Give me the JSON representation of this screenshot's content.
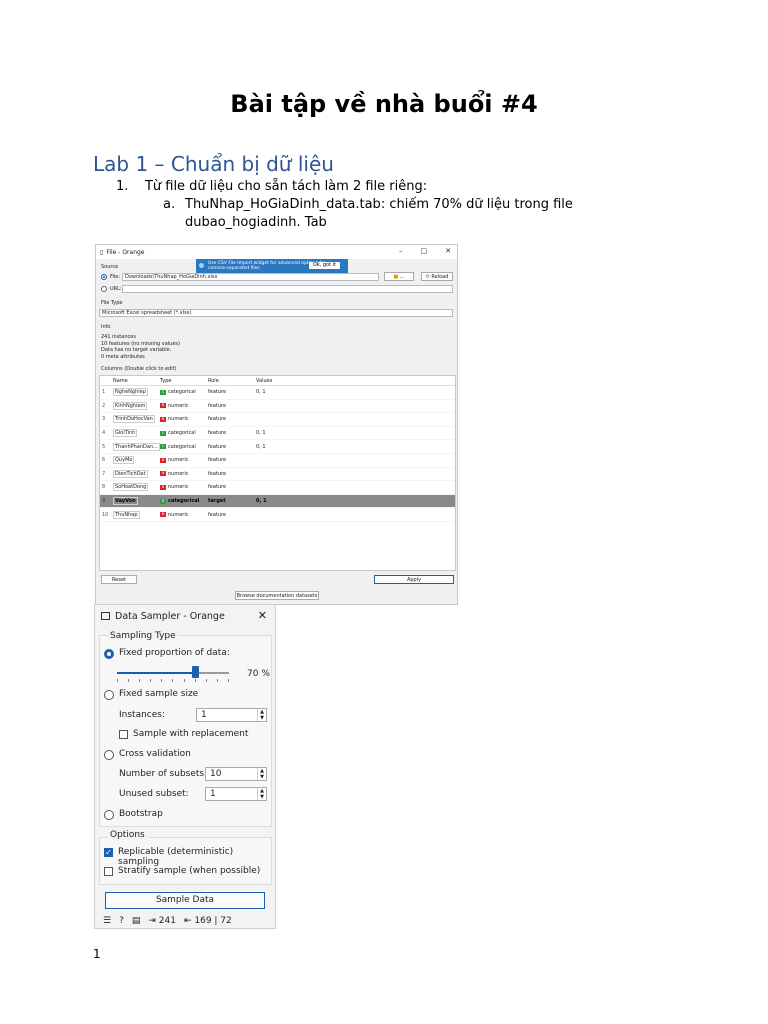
{
  "doc": {
    "title": "Bài tập về nhà buổi #4",
    "lab_heading": "Lab 1 – Chuẩn bị dữ liệu",
    "item1_marker": "1.",
    "item1_text": "Từ file dữ liệu cho sẵn tách làm 2 file riêng:",
    "itema_marker": "a.",
    "itema_text": "ThuNhap_HoGiaDinh_data.tab: chiếm 70% dữ liệu trong file dubao_hogiadinh. Tab",
    "page_number": "1"
  },
  "file_window": {
    "title": "File - Orange",
    "source_label": "Source",
    "file_label": "File:",
    "file_path": "Downloads\\ThuNhap_HoGiaDinh.xlsx",
    "url_label": "URL:",
    "browse_label": "...",
    "reload_label": "Reload",
    "tooltip_text": "Use CSV File Import widget for advanced options for comma-separated files",
    "tooltip_ok": "Ok, got it",
    "file_type_label": "File Type",
    "file_type_value": "Microsoft Excel spreadsheet (*.xlsx)",
    "info_label": "Info",
    "info_lines": [
      "241 instances",
      "10 features (no missing values)",
      "Data has no target variable.",
      "0 meta attributes"
    ],
    "columns_label": "Columns (Double click to edit)",
    "headers": {
      "name": "Name",
      "type": "Type",
      "role": "Role",
      "values": "Values"
    },
    "rows": [
      {
        "num": "1",
        "name": "NgheNghiep",
        "type": "categorical",
        "role": "feature",
        "values": "0, 1"
      },
      {
        "num": "2",
        "name": "KinhNghiem",
        "type": "numeric",
        "role": "feature",
        "values": ""
      },
      {
        "num": "3",
        "name": "TrinhDoHocVan",
        "type": "numeric",
        "role": "feature",
        "values": ""
      },
      {
        "num": "4",
        "name": "GioiTinh",
        "type": "categorical",
        "role": "feature",
        "values": "0, 1"
      },
      {
        "num": "5",
        "name": "ThanhPhanDan...",
        "type": "categorical",
        "role": "feature",
        "values": "0, 1"
      },
      {
        "num": "6",
        "name": "QuyMo",
        "type": "numeric",
        "role": "feature",
        "values": ""
      },
      {
        "num": "7",
        "name": "DienTichDat",
        "type": "numeric",
        "role": "feature",
        "values": ""
      },
      {
        "num": "8",
        "name": "SoHoatDong",
        "type": "numeric",
        "role": "feature",
        "values": ""
      },
      {
        "num": "9",
        "name": "VayVon",
        "type": "categorical",
        "role": "target",
        "values": "0, 1"
      },
      {
        "num": "10",
        "name": "ThuNhap",
        "type": "numeric",
        "role": "feature",
        "values": ""
      }
    ],
    "reset_label": "Reset",
    "apply_label": "Apply",
    "browse_docs_label": "Browse documentation datasets"
  },
  "sampler_window": {
    "title": "Data Sampler - Orange",
    "sampling_type_label": "Sampling Type",
    "fixed_proportion_label": "Fixed proportion of data:",
    "proportion_value": "70 %",
    "proportion_fraction": 0.7,
    "fixed_size_label": "Fixed sample size",
    "instances_label": "Instances:",
    "instances_value": "1",
    "replacement_label": "Sample with replacement",
    "cross_validation_label": "Cross validation",
    "subsets_label": "Number of subsets:",
    "subsets_value": "10",
    "unused_label": "Unused subset:",
    "unused_value": "1",
    "bootstrap_label": "Bootstrap",
    "options_label": "Options",
    "replicable_label": "Replicable (deterministic) sampling",
    "stratify_label": "Stratify sample (when possible)",
    "sample_button": "Sample Data",
    "status_in": "241",
    "status_out": "169 | 72"
  }
}
